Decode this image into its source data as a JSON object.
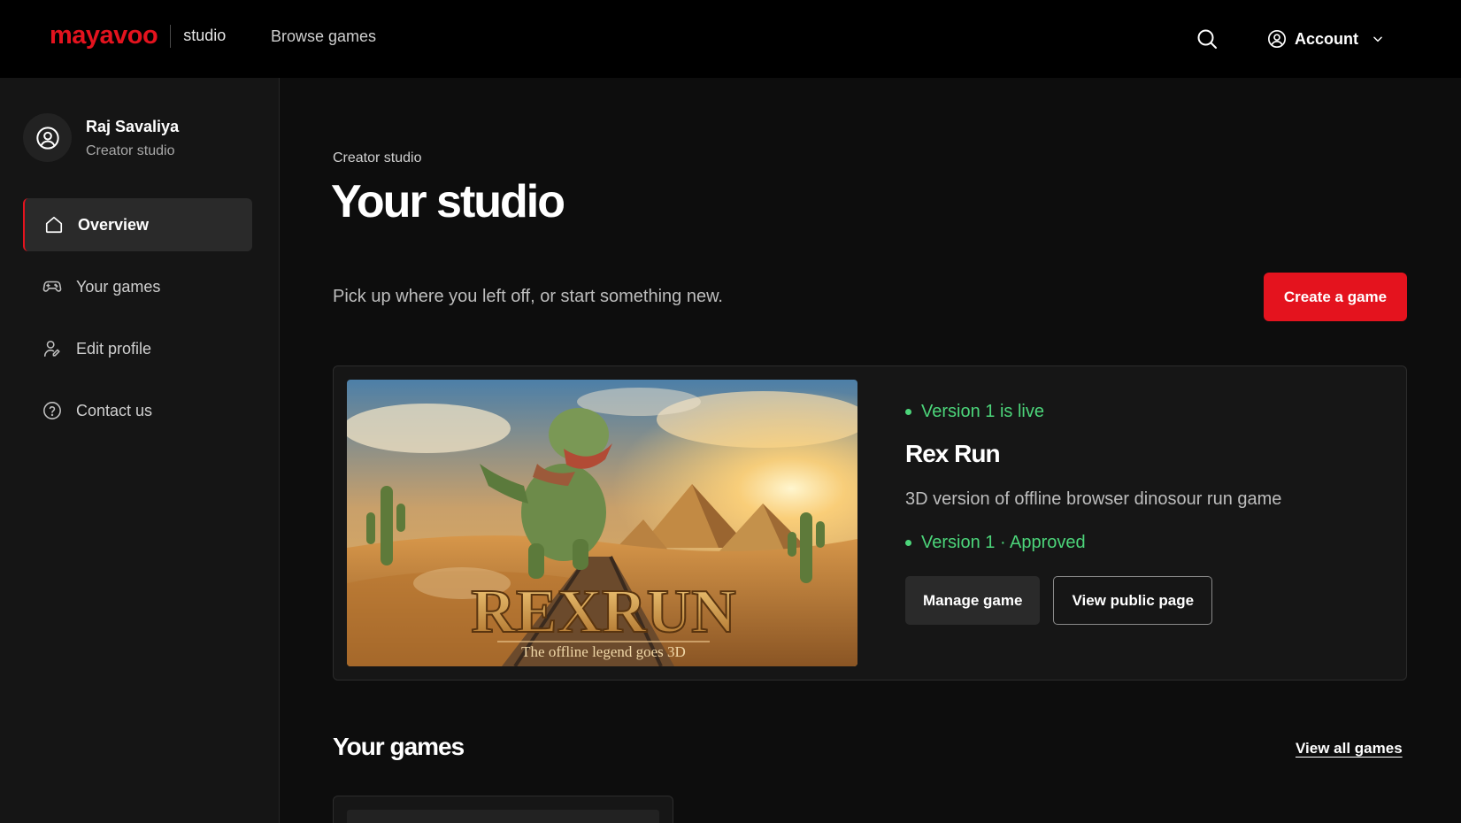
{
  "header": {
    "brand": "mayavoo",
    "brand_suffix": "studio",
    "browse_label": "Browse games",
    "account_label": "Account",
    "icons": {
      "search": "search-icon",
      "account": "user-circle-icon",
      "chevron": "chevron-down-icon"
    }
  },
  "sidebar": {
    "user_name": "Raj Savaliya",
    "user_role": "Creator studio",
    "items": [
      {
        "label": "Overview",
        "icon": "home-icon",
        "active": true
      },
      {
        "label": "Your games",
        "icon": "gamepad-icon",
        "active": false
      },
      {
        "label": "Edit profile",
        "icon": "user-edit-icon",
        "active": false
      },
      {
        "label": "Contact us",
        "icon": "help-circle-icon",
        "active": false
      }
    ]
  },
  "main": {
    "breadcrumb": "Creator studio",
    "title": "Your studio",
    "subtitle": "Pick up where you left off, or start something new.",
    "create_button": "Create a game",
    "featured": {
      "status_live": "Version 1 is live",
      "title": "Rex Run",
      "description": "3D version of offline browser dinosour run game",
      "status_version": "Version 1 · Approved",
      "manage_button": "Manage game",
      "view_button": "View public page",
      "thumbnail_title": "REXRUN",
      "thumbnail_tagline": "The offline legend goes 3D"
    },
    "games_section_title": "Your games",
    "view_all_link": "View all games"
  },
  "colors": {
    "accent": "#e4131e",
    "success": "#4cd57a",
    "background": "#0d0d0d",
    "sidebar": "#151515",
    "card": "#161616"
  }
}
